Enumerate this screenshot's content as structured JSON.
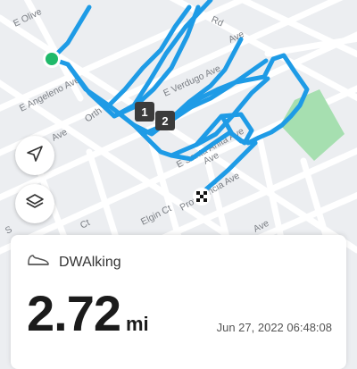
{
  "map": {
    "street_labels": [
      "E Olive",
      "Rd",
      "E Angeleno Ave",
      "E Verdugo Ave",
      "Ave",
      "Orth",
      "E Santa Anita Ave",
      "Providencia Ave",
      "Ave",
      "Ct",
      "Elgin Ct",
      "Ave",
      "S",
      "Ave"
    ],
    "checkpoints": [
      "1",
      "2"
    ],
    "route_color": "#1e9be6",
    "start_marker_color": "#1fb96a",
    "park_color": "#a6dfb0"
  },
  "controls": {
    "locate_icon": "navigation-arrow-icon",
    "layers_icon": "layers-icon"
  },
  "summary": {
    "activity_icon": "shoe-icon",
    "activity_label": "DWAlking",
    "distance_value": "2.72",
    "distance_unit": "mi",
    "timestamp": "Jun 27, 2022 06:48:08"
  }
}
